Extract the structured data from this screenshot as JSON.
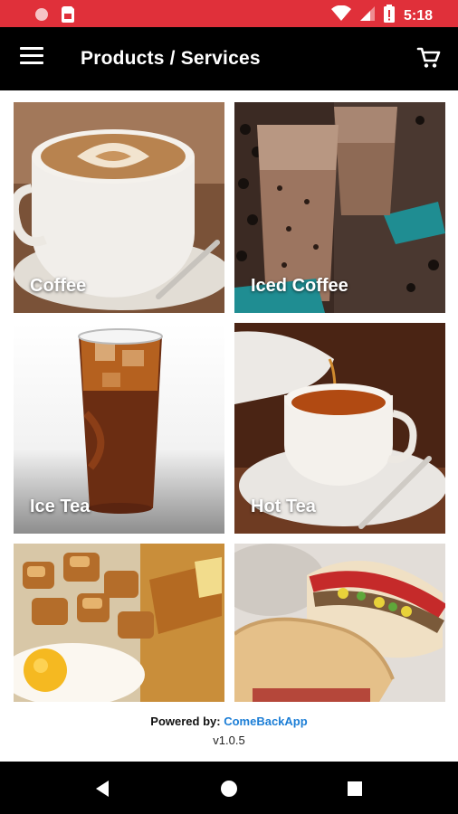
{
  "status_bar": {
    "time": "5:18",
    "icons": [
      "notification-dot-icon",
      "sim-card-icon",
      "wifi-icon",
      "signal-icon",
      "battery-icon"
    ]
  },
  "app_bar": {
    "title": "Products / Services",
    "menu_icon": "hamburger-menu-icon",
    "cart_icon": "shopping-cart-icon"
  },
  "products": [
    {
      "label": "Coffee"
    },
    {
      "label": "Iced Coffee"
    },
    {
      "label": "Ice Tea"
    },
    {
      "label": "Hot Tea"
    },
    {
      "label": ""
    },
    {
      "label": ""
    }
  ],
  "footer": {
    "powered_by": "Powered by:",
    "brand": "ComeBackApp",
    "version": "v1.0.5"
  },
  "nav_bar": {
    "buttons": [
      "back-icon",
      "home-icon",
      "recents-icon"
    ]
  },
  "colors": {
    "status_bar": "#e0303a",
    "app_bar": "#000000",
    "brand_link": "#1c7ed6"
  }
}
